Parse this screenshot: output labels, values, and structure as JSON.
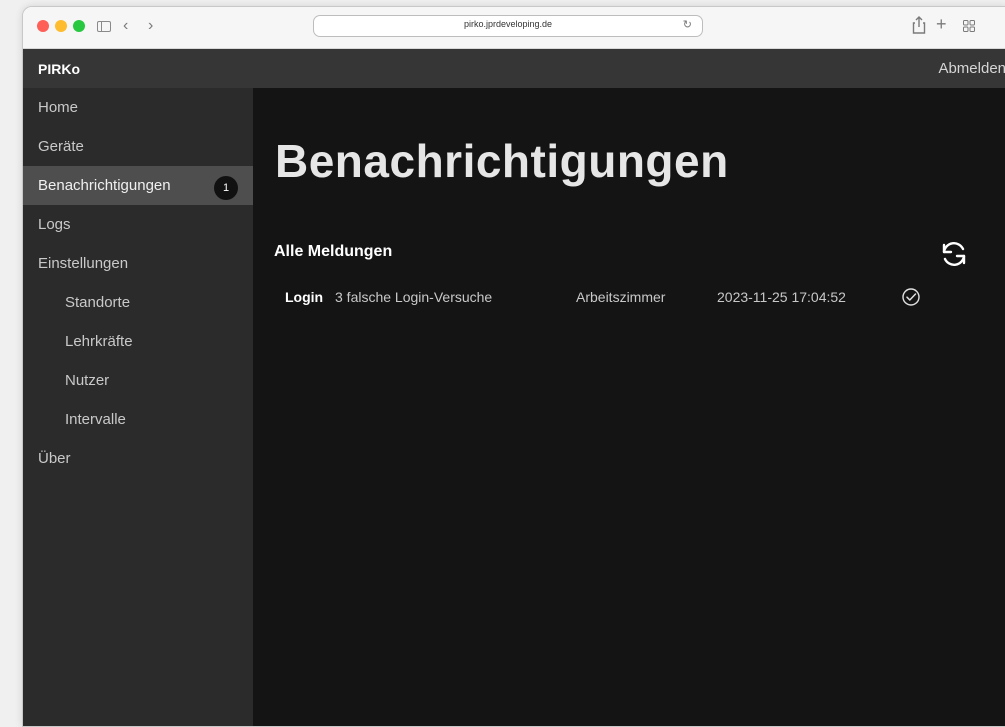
{
  "browser": {
    "url": "pirko.jprdeveloping.de",
    "icons": [
      "sidebar-icon",
      "chevron-left-icon",
      "chevron-right-icon",
      "reload-icon",
      "share-icon",
      "plus-icon",
      "tabs-grid-icon"
    ]
  },
  "header": {
    "brand": "PIRKo",
    "logout_label": "Abmelden"
  },
  "sidebar": {
    "items": [
      {
        "label": "Home"
      },
      {
        "label": "Geräte"
      },
      {
        "label": "Benachrichtigungen",
        "badge": "1",
        "active": true
      },
      {
        "label": "Logs"
      },
      {
        "label": "Einstellungen"
      },
      {
        "label": "Standorte",
        "sub": true
      },
      {
        "label": "Lehrkräfte",
        "sub": true
      },
      {
        "label": "Nutzer",
        "sub": true
      },
      {
        "label": "Intervalle",
        "sub": true
      },
      {
        "label": "Über"
      }
    ]
  },
  "main": {
    "title": "Benachrichtigungen",
    "section_title": "Alle Meldungen",
    "notifications": [
      {
        "type": "Login",
        "message": "3 falsche Login-Versuche",
        "room": "Arbeitszimmer",
        "timestamp": "2023-11-25 17:04:52"
      }
    ]
  },
  "colors": {
    "header_bg": "#363636",
    "sidebar_bg": "#2b2b2b",
    "sidebar_active_bg": "#4e4e4e",
    "main_bg": "#141414",
    "badge_bg": "#111111"
  }
}
